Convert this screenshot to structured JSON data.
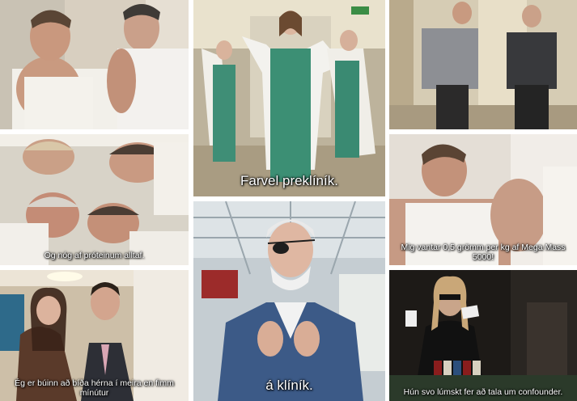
{
  "panels": [
    {
      "id": "p1",
      "caption": ""
    },
    {
      "id": "p2",
      "caption": "Farvel preklíník."
    },
    {
      "id": "p3",
      "caption": ""
    },
    {
      "id": "p4",
      "caption": "Og nóg af próteinum alltaf."
    },
    {
      "id": "p5",
      "caption": "Mig vantar 0,5 grömm per kg af Mega Mass 5000!"
    },
    {
      "id": "p6",
      "caption": "á klíník."
    },
    {
      "id": "p7",
      "caption": "Ég er búinn að bíða hérna í meira en fimm mínútur"
    },
    {
      "id": "p8",
      "caption": "Hún svo lúmskt fer að tala um confounder."
    }
  ]
}
